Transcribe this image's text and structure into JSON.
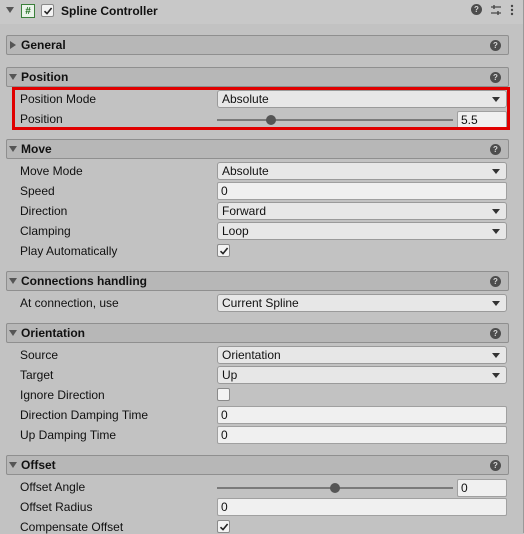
{
  "component": {
    "title": "Spline Controller",
    "script_icon": "#"
  },
  "sections": {
    "general": "General",
    "position": "Position",
    "move": "Move",
    "connections": "Connections handling",
    "orientation": "Orientation",
    "offset": "Offset"
  },
  "position": {
    "mode_label": "Position Mode",
    "mode_value": "Absolute",
    "position_label": "Position",
    "position_value": "5.5",
    "slider_fraction": 0.23
  },
  "move": {
    "mode_label": "Move Mode",
    "mode_value": "Absolute",
    "speed_label": "Speed",
    "speed_value": "0",
    "direction_label": "Direction",
    "direction_value": "Forward",
    "clamping_label": "Clamping",
    "clamping_value": "Loop",
    "play_label": "Play Automatically",
    "play_checked": true
  },
  "connections": {
    "at_label": "At connection, use",
    "at_value": "Current Spline"
  },
  "orientation": {
    "source_label": "Source",
    "source_value": "Orientation",
    "target_label": "Target",
    "target_value": "Up",
    "ignore_label": "Ignore Direction",
    "ignore_checked": false,
    "dir_damp_label": "Direction Damping Time",
    "dir_damp_value": "0",
    "up_damp_label": "Up Damping Time",
    "up_damp_value": "0"
  },
  "offset": {
    "angle_label": "Offset Angle",
    "angle_value": "0",
    "angle_slider_fraction": 0.5,
    "radius_label": "Offset Radius",
    "radius_value": "0",
    "compensate_label": "Compensate Offset",
    "compensate_checked": true
  },
  "icons": [
    "help-icon",
    "presets-icon",
    "menu-icon",
    "foldout-arrow-icon",
    "checkmark-icon"
  ]
}
